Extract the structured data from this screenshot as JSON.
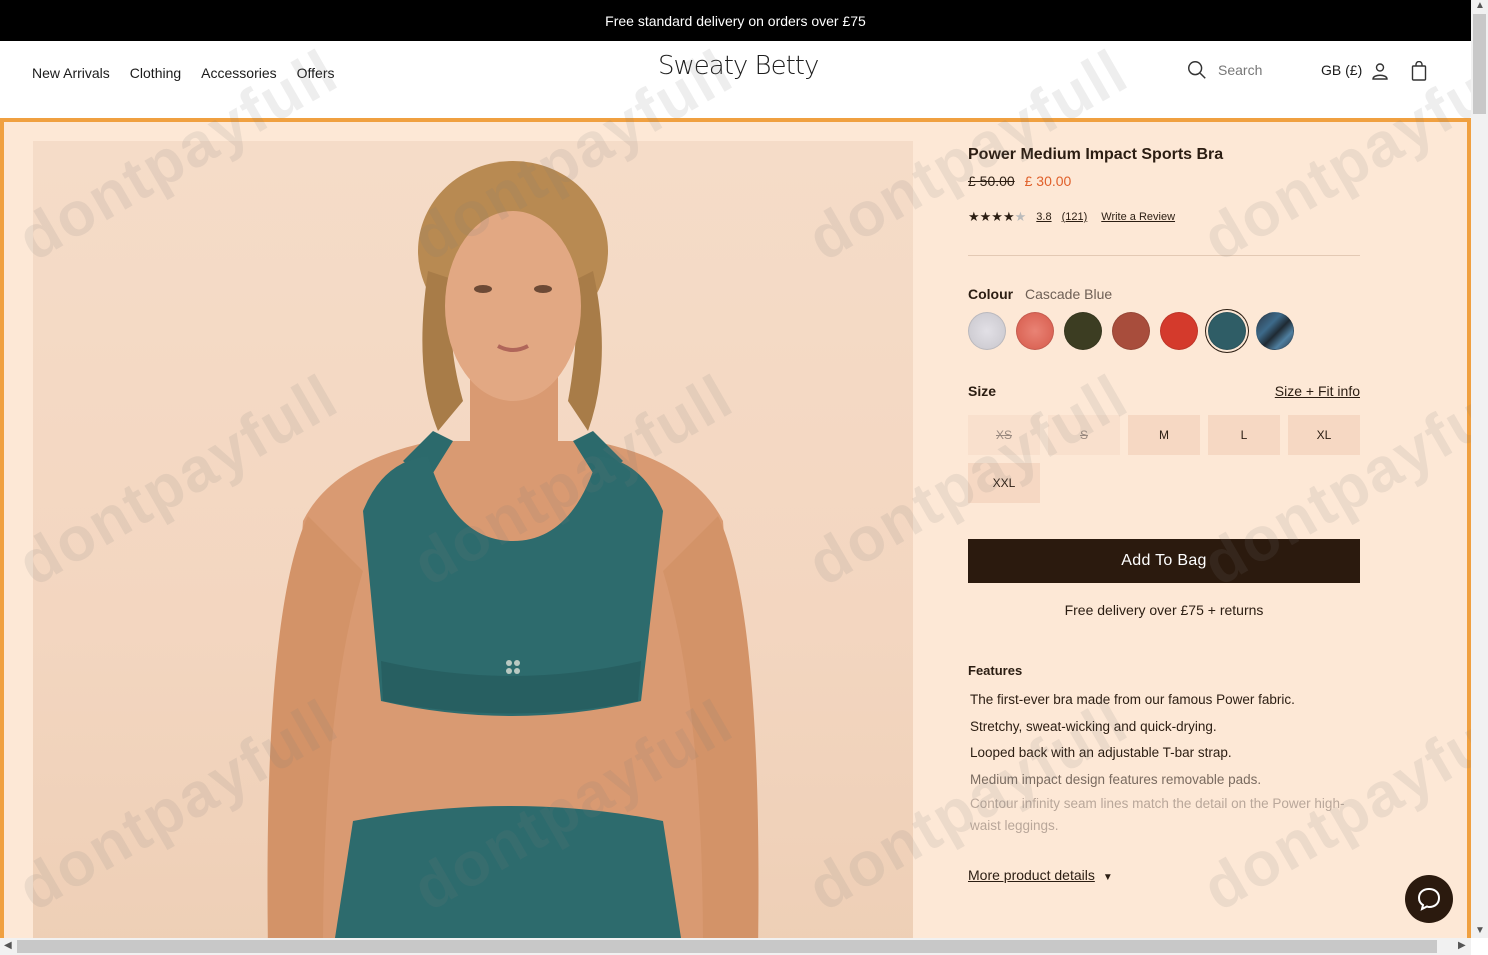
{
  "announcement": "Free standard delivery on orders over £75",
  "nav": {
    "items": [
      "New Arrivals",
      "Clothing",
      "Accessories",
      "Offers"
    ]
  },
  "brand": "Sweaty Betty",
  "search": {
    "placeholder": "Search"
  },
  "locale": "GB (£)",
  "product": {
    "title": "Power Medium Impact Sports Bra",
    "was_price": "£ 50.00",
    "now_price": "£ 30.00",
    "rating": "3.8",
    "review_count": "(121)",
    "write_review": "Write a Review",
    "stars_value": 3.8
  },
  "colour": {
    "label": "Colour",
    "selected": "Cascade Blue",
    "swatches": [
      {
        "name": "grey-marl",
        "color": "#d4d2d8"
      },
      {
        "name": "coral-marl",
        "color": "#e0695a"
      },
      {
        "name": "olive",
        "color": "#3c3d22"
      },
      {
        "name": "rust",
        "color": "#a84d3c"
      },
      {
        "name": "red",
        "color": "#d43a2c"
      },
      {
        "name": "cascade-blue",
        "color": "#2f5d66"
      },
      {
        "name": "blue-print",
        "color": "#2c3846"
      }
    ]
  },
  "size": {
    "label": "Size",
    "fit_link": "Size + Fit info",
    "options": [
      {
        "label": "XS",
        "available": false
      },
      {
        "label": "S",
        "available": false
      },
      {
        "label": "M",
        "available": true
      },
      {
        "label": "L",
        "available": true
      },
      {
        "label": "XL",
        "available": true
      },
      {
        "label": "XXL",
        "available": true
      }
    ]
  },
  "add_to_bag": "Add To Bag",
  "delivery_note": "Free delivery over £75 + returns",
  "features": {
    "title": "Features",
    "items": [
      "The first-ever bra made from our famous Power fabric.",
      "Stretchy, sweat-wicking and quick-drying.",
      "Looped back with an adjustable T-bar strap.",
      "Medium impact design features removable pads.",
      "Contour infinity seam lines match the detail on the Power high-waist leggings."
    ]
  },
  "more_details": "More product details",
  "watermark": "dontpayfull",
  "colors": {
    "accent_border": "#f0a040",
    "sale_price": "#e0602a",
    "button_bg": "#2b1a0e",
    "page_bg": "#fde8d6"
  }
}
